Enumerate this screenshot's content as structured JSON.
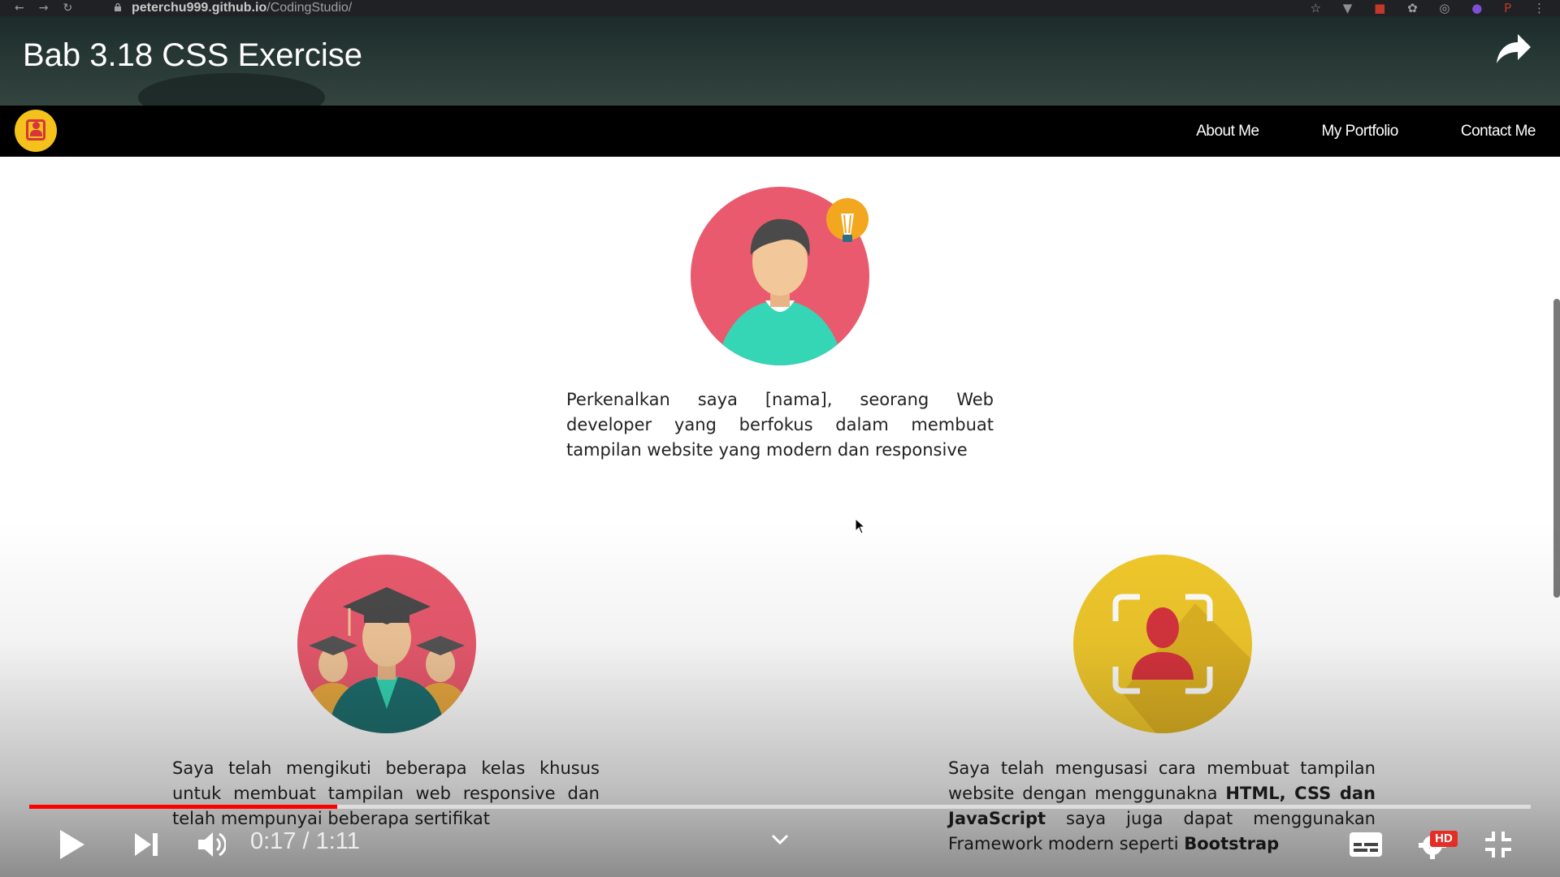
{
  "browser": {
    "url_host": "peterchu999.github.io",
    "url_path": "/CodingStudio/"
  },
  "video": {
    "title": "Bab 3.18 CSS Exercise",
    "time_current": "0:17",
    "time_total": "1:11",
    "time_display": "0:17 / 1:11",
    "progress_fraction": 0.205,
    "hd_badge": "HD",
    "colors": {
      "progress": "#ff0000"
    }
  },
  "site": {
    "nav": {
      "links": [
        "About Me",
        "My Portfolio",
        "Contact Me"
      ]
    },
    "intro": {
      "text": "Perkenalkan saya [nama], seorang Web developer yang berfokus dalam membuat tampilan website yang modern dan responsive"
    },
    "cards": [
      {
        "text": "Saya telah mengikuti beberapa kelas khusus untuk membuat tampilan web responsive dan telah mempunyai beberapa sertifikat"
      },
      {
        "text_before": "Saya telah mengusasi cara membuat tampilan website dengan menggunakna ",
        "text_bold": "HTML, CSS dan JavaScript",
        "text_middle": " saya juga dapat menggunakan Framework modern seperti ",
        "text_bold2": "Bootstrap"
      }
    ],
    "colors": {
      "nav_bg": "#000000",
      "pink": "#ea5a6e",
      "teal": "#35d6b5",
      "yellow": "#f1c92c",
      "red": "#d8343e"
    }
  },
  "icons": {
    "browser": [
      "back-icon",
      "forward-icon",
      "reload-icon",
      "lock-icon",
      "star-icon",
      "extension-icon",
      "menu-icon"
    ],
    "video": [
      "share-icon",
      "play-icon",
      "next-icon",
      "volume-icon",
      "chevron-down-icon",
      "subtitles-icon",
      "settings-icon",
      "exit-fullscreen-icon"
    ]
  }
}
